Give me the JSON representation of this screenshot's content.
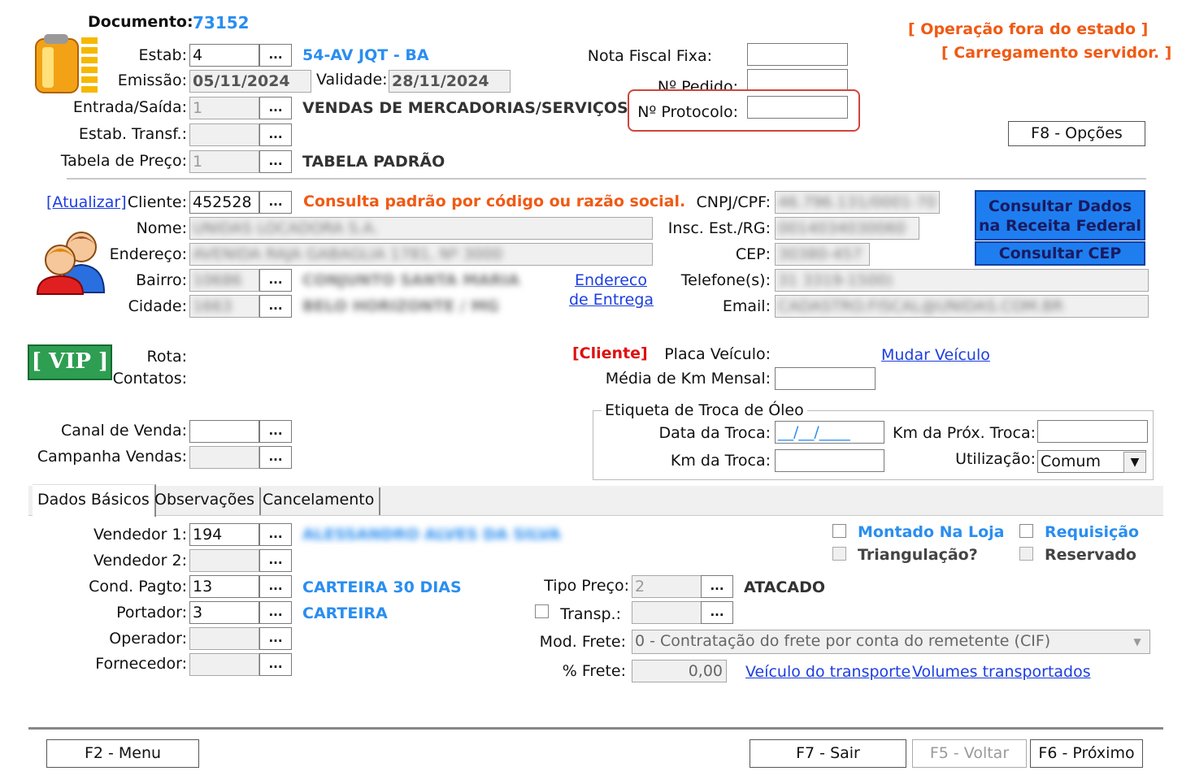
{
  "header": {
    "doc_label": "Documento:",
    "doc_number": "73152",
    "estab_label": "Estab:",
    "estab_value": "4",
    "estab_name": "54-AV JQT - BA",
    "emissao_label": "Emissão:",
    "emissao_value": "05/11/2024",
    "validade_label": "Validade:",
    "validade_value": "28/11/2024",
    "entrada_label": "Entrada/Saída:",
    "entrada_value": "1",
    "entrada_desc": "VENDAS DE MERCADORIAS/SERVIÇOS",
    "transf_label": "Estab. Transf.:",
    "tabela_label": "Tabela de Preço:",
    "tabela_value": "1",
    "tabela_desc": "TABELA PADRÃO",
    "nota_fixa_label": "Nota Fiscal Fixa:",
    "pedido_label": "Nº Pedido:",
    "protocolo_label": "Nº Protocolo:",
    "status1": "[ Operação fora do estado ]",
    "status2": "[ Carregamento servidor. ]",
    "f8_label": "F8 - Opções"
  },
  "client": {
    "atualizar_link": "[Atualizar]",
    "cliente_label": "Cliente:",
    "cliente_value": "452528",
    "cliente_hint": "Consulta padrão por código ou razão social.",
    "nome_label": "Nome:",
    "nome_value": "UNIDAS LOCADORA S.A.",
    "endereco_label": "Endereço:",
    "endereco_value": "AVENIDA RAJA GABAGLIA 1781, Nº 3000",
    "bairro_label": "Bairro:",
    "bairro_code": "10686",
    "bairro_name": "CONJUNTO SANTA MARIA",
    "cidade_label": "Cidade:",
    "cidade_code": "1663",
    "cidade_name": "BELO HORIZONTE / MG",
    "endereco_entrega_1": "Endereco",
    "endereco_entrega_2": "de Entrega",
    "cnpj_label": "CNPJ/CPF:",
    "cnpj_value": "46.796.131/0001-70",
    "insc_label": "Insc. Est./RG:",
    "insc_value": "0014034030060",
    "cep_label": "CEP:",
    "cep_value": "30380-457",
    "telefone_label": "Telefone(s):",
    "telefone_value": "31 3319-1500)",
    "email_label": "Email:",
    "email_value": "CADASTRO.FISCAL@UNIDAS.COM.BR",
    "receita_btn_1": "Consultar Dados",
    "receita_btn_2": "na Receita Federal",
    "cep_btn": "Consultar CEP"
  },
  "extra": {
    "vip": "[ VIP ]",
    "rota_label": "Rota:",
    "contatos_label": "Contatos:",
    "cliente_tag": "[Cliente]",
    "placa_label": "Placa Veículo:",
    "mudar_veiculo": "Mudar Veículo",
    "media_km_label": "Média de Km Mensal:",
    "canal_label": "Canal de Venda:",
    "campanha_label": "Campanha Vendas:",
    "oil_group": "Etiqueta de Troca de Óleo",
    "data_troca_label": "Data da Troca:",
    "data_troca_value": "__/__/____",
    "km_troca_label": "Km da Troca:",
    "km_prox_label": "Km da Próx. Troca:",
    "utilizacao_label": "Utilização:",
    "utilizacao_value": "Comum"
  },
  "tabs": [
    "Dados Básicos",
    "Observações",
    "Cancelamento"
  ],
  "basic": {
    "vendedor1_label": "Vendedor 1:",
    "vendedor1_value": "194",
    "vendedor1_name": "ALESSANDRO ALVES DA SILVA",
    "vendedor2_label": "Vendedor 2:",
    "cond_label": "Cond. Pagto:",
    "cond_value": "13",
    "cond_desc": "CARTEIRA 30 DIAS",
    "portador_label": "Portador:",
    "portador_value": "3",
    "portador_desc": "CARTEIRA",
    "operador_label": "Operador:",
    "fornecedor_label": "Fornecedor:",
    "montado_label": "Montado Na Loja",
    "requisicao_label": "Requisição",
    "triangulacao_label": "Triangulação?",
    "reservado_label": "Reservado",
    "tipo_preco_label": "Tipo Preço:",
    "tipo_preco_value": "2",
    "tipo_preco_desc": "ATACADO",
    "transp_label": "Transp.:",
    "mod_frete_label": "Mod. Frete:",
    "mod_frete_value": "0 - Contratação do frete por conta do remetente (CIF)",
    "frete_label": "% Frete:",
    "frete_value": "0,00",
    "veiculo_link": "Veículo do transporte",
    "volumes_link": "Volumes transportados"
  },
  "footer": {
    "f2": "F2 - Menu",
    "f7": "F7 - Sair",
    "f5": "F5 - Voltar",
    "f6": "F6 - Próximo"
  },
  "colors": {
    "accent_blue": "#2a8ef0",
    "orange": "#f05a14",
    "highlight": "#d0443a",
    "vip_green": "#2e9e52"
  }
}
